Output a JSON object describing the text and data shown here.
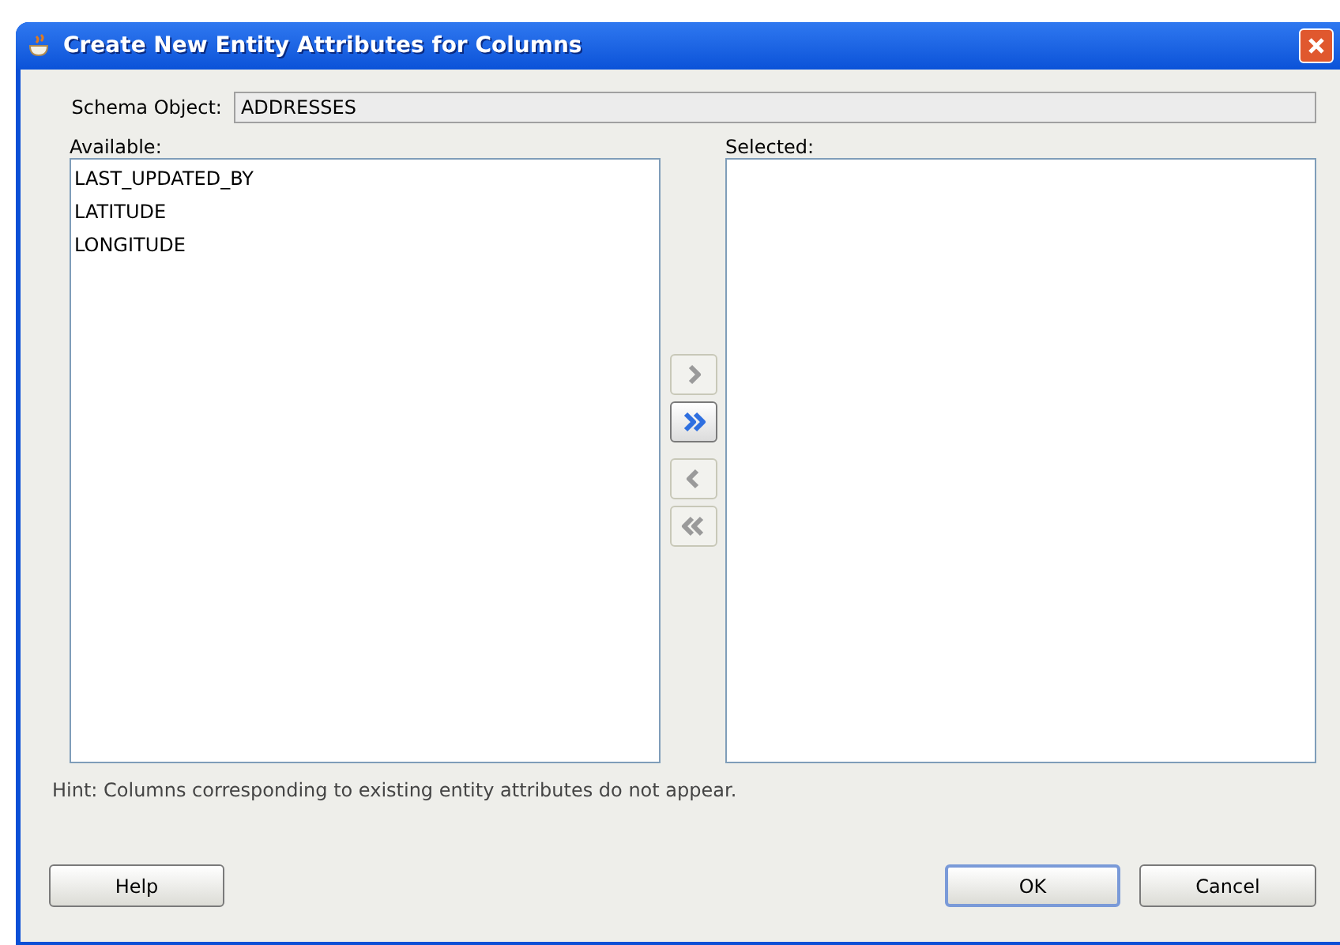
{
  "window": {
    "title": "Create New Entity Attributes for Columns"
  },
  "schema_object": {
    "label": "Schema Object:",
    "value": "ADDRESSES"
  },
  "available": {
    "label": "Available:",
    "items": [
      "LAST_UPDATED_BY",
      "LATITUDE",
      "LONGITUDE"
    ]
  },
  "selected": {
    "label": "Selected:"
  },
  "shuttle_buttons": [
    {
      "kind": "add",
      "disabled": true
    },
    {
      "kind": "add_all",
      "disabled": false
    },
    {
      "kind": "remove",
      "disabled": true
    },
    {
      "kind": "remove_all",
      "disabled": true
    }
  ],
  "hint": "Hint: Columns corresponding to existing entity attributes do not appear.",
  "buttons": {
    "help": "Help",
    "ok": "OK",
    "cancel": "Cancel"
  }
}
